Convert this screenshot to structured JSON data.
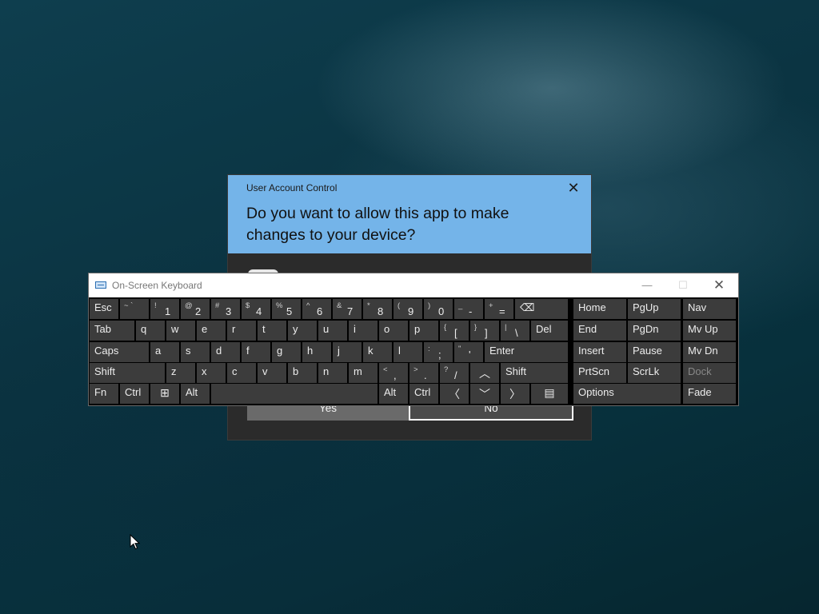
{
  "uac": {
    "title": "User Account Control",
    "question": "Do you want to allow this app to make changes to your device?",
    "close_glyph": "✕",
    "yes_label": "Yes",
    "no_label": "No",
    "header_color": "#74b4e9"
  },
  "osk": {
    "title": "On-Screen Keyboard",
    "minimize_glyph": "—",
    "maximize_glyph": "☐",
    "close_glyph": "✕",
    "keys": {
      "esc": "Esc",
      "tilde": {
        "shift": "~ `",
        "main": ""
      },
      "k1": {
        "shift": "!",
        "main": "1"
      },
      "k2": {
        "shift": "@",
        "main": "2"
      },
      "k3": {
        "shift": "#",
        "main": "3"
      },
      "k4": {
        "shift": "$",
        "main": "4"
      },
      "k5": {
        "shift": "%",
        "main": "5"
      },
      "k6": {
        "shift": "^",
        "main": "6"
      },
      "k7": {
        "shift": "&",
        "main": "7"
      },
      "k8": {
        "shift": "*",
        "main": "8"
      },
      "k9": {
        "shift": "(",
        "main": "9"
      },
      "k0": {
        "shift": ")",
        "main": "0"
      },
      "minus": {
        "shift": "_",
        "main": "-"
      },
      "equal": {
        "shift": "+",
        "main": "="
      },
      "backspace_glyph": "⌫",
      "home": "Home",
      "pgup": "PgUp",
      "nav": "Nav",
      "tab": "Tab",
      "q": "q",
      "w": "w",
      "e": "e",
      "r": "r",
      "t": "t",
      "y": "y",
      "u": "u",
      "i": "i",
      "o": "o",
      "p": "p",
      "lbracket": {
        "shift": "{",
        "main": "["
      },
      "rbracket": {
        "shift": "}",
        "main": "]"
      },
      "backslash": {
        "shift": "|",
        "main": "\\"
      },
      "del": "Del",
      "end": "End",
      "pgdn": "PgDn",
      "mvup": "Mv Up",
      "caps": "Caps",
      "a": "a",
      "s": "s",
      "d": "d",
      "f": "f",
      "g": "g",
      "h": "h",
      "j": "j",
      "k": "k",
      "l": "l",
      "semicolon": {
        "shift": ":",
        "main": ";"
      },
      "quote": {
        "shift": "\"",
        "main": "'"
      },
      "enter": "Enter",
      "insert": "Insert",
      "pause": "Pause",
      "mvdn": "Mv Dn",
      "shift_left": "Shift",
      "z": "z",
      "x": "x",
      "c": "c",
      "v": "v",
      "b": "b",
      "n": "n",
      "m": "m",
      "comma": {
        "shift": "<",
        "main": ","
      },
      "period": {
        "shift": ">",
        "main": "."
      },
      "slash": {
        "shift": "?",
        "main": "/"
      },
      "up_glyph": "︿",
      "shift_right": "Shift",
      "prtscn": "PrtScn",
      "scrlk": "ScrLk",
      "dock": "Dock",
      "fn": "Fn",
      "ctrl_left": "Ctrl",
      "win_glyph": "⊞",
      "alt_left": "Alt",
      "alt_right": "Alt",
      "ctrl_right": "Ctrl",
      "left_glyph": "〈",
      "down_glyph": "﹀",
      "right_glyph": "〉",
      "menu_glyph": "▤",
      "options": "Options",
      "fade": "Fade"
    }
  }
}
